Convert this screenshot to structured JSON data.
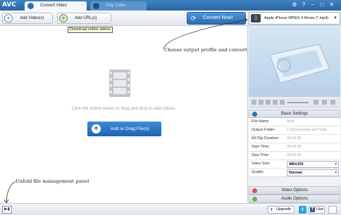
{
  "titlebar": {
    "logo": "AVC",
    "tabs": [
      {
        "label": "Convert Video",
        "active": true
      },
      {
        "label": "Play Video",
        "active": false
      }
    ],
    "window_buttons": [
      "?",
      "–",
      "□",
      "✕"
    ],
    "accent": "#2b64a3"
  },
  "toolbar": {
    "add_video_label": "Add Video(s)",
    "add_url_label": "Add URL(s)",
    "tooltip": "Download online videos",
    "convert_label": "Convert Now!",
    "profile_value": "Apple iPhone MPEG-4 Movie (*.mp4)"
  },
  "main": {
    "hint": "Click the button below or drag and drop to add videos.",
    "add_drag_label": "Add or Drag File(s)",
    "annotation_choose": "Choose output profile and convert",
    "annotation_unfold": "Unfold file management panel"
  },
  "right_panel": {
    "basic_settings": "Basic Settings",
    "rows": [
      {
        "label": "File Name:",
        "value": "Auto"
      },
      {
        "label": "Output Folder:",
        "value": "C:\\Documents and Setti..."
      },
      {
        "label": "All Clip Duration:",
        "value": "00:00:00"
      },
      {
        "label": "Start Time:",
        "value": "00:00:00"
      },
      {
        "label": "Stop Time:",
        "value": "00:00:00"
      },
      {
        "label": "Video Size:",
        "value": "480x320"
      },
      {
        "label": "Quality:",
        "value": "Normal"
      }
    ],
    "video_options": "Video Options",
    "audio_options": "Audio Options"
  },
  "statusbar": {
    "upgrade_label": "Upgrade",
    "like_label": "Like"
  }
}
